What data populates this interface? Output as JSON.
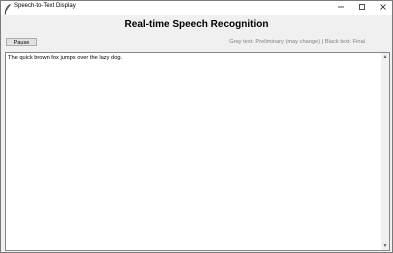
{
  "window": {
    "title": "Speech-to-Text Display",
    "icons": [
      "feather-icon",
      "minimize-icon",
      "maximize-icon",
      "close-icon"
    ]
  },
  "main": {
    "heading": "Real-time Speech Recognition",
    "pause_label": "Pause",
    "legend": "Gray text: Preliminary (may change) | Black text: Final",
    "transcript": "The quick brown fox jumps over the lazy dog."
  },
  "colors": {
    "preliminary_text": "#808080",
    "final_text": "#000000"
  }
}
